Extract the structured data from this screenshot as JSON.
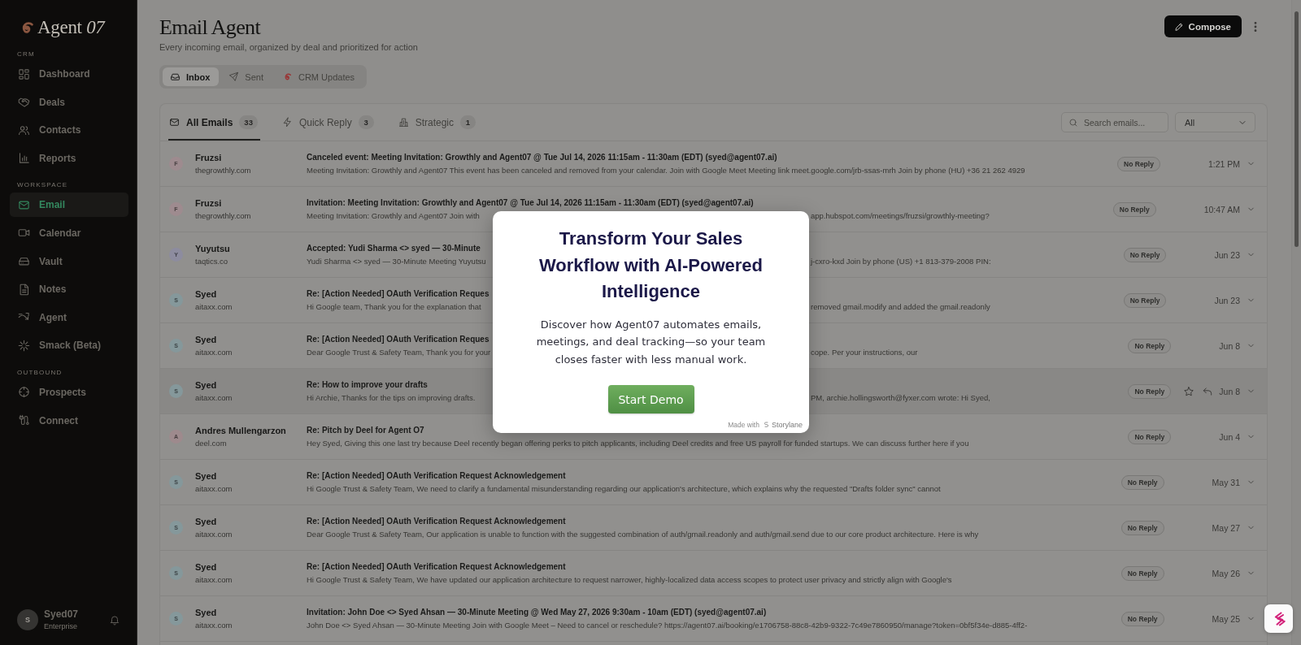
{
  "sidebar": {
    "logo": "Agent *07*",
    "sections": [
      {
        "label": "CRM",
        "items": [
          {
            "label": "Dashboard",
            "selected": false
          },
          {
            "label": "Deals",
            "selected": false
          },
          {
            "label": "Contacts",
            "selected": false
          },
          {
            "label": "Reports",
            "selected": false
          }
        ]
      },
      {
        "label": "WORKSPACE",
        "items": [
          {
            "label": "Email",
            "selected": true
          },
          {
            "label": "Calendar",
            "selected": false
          },
          {
            "label": "Vault",
            "selected": false
          },
          {
            "label": "Notes",
            "selected": false
          },
          {
            "label": "Agent",
            "selected": false
          },
          {
            "label": "Smack (Beta)",
            "selected": false
          }
        ]
      },
      {
        "label": "OUTBOUND",
        "items": [
          {
            "label": "Prospects",
            "selected": false
          },
          {
            "label": "Connect",
            "selected": false
          }
        ]
      }
    ],
    "user": {
      "initial": "S",
      "name": "Syed07",
      "plan": "Enterprise"
    }
  },
  "header": {
    "title": "Email Agent",
    "subtitle": "Every incoming email, organized by deal and prioritized for action",
    "compose_button": "Compose"
  },
  "view_tabs": [
    {
      "label": "Inbox",
      "selected": true
    },
    {
      "label": "Sent",
      "selected": false
    },
    {
      "label": "CRM Updates",
      "selected": false
    }
  ],
  "mail_tabs": [
    {
      "label": "All Emails",
      "count": "33",
      "selected": true
    },
    {
      "label": "Quick Reply",
      "count": "3",
      "selected": false
    },
    {
      "label": "Strategic",
      "count": "1",
      "selected": false
    }
  ],
  "search": {
    "placeholder": "Search emails..."
  },
  "filter": {
    "value": "All"
  },
  "emails": [
    {
      "initial": "F",
      "color": "#9e8b8f",
      "sender": "Fruzsi",
      "domain": "thegrowthly.com",
      "subject": "Canceled event: Meeting Invitation: Growthly and Agent07 @ Tue Jul 14, 2026 11:15am - 11:30am (EDT) (syed@agent07.ai)",
      "preview": "Meeting Invitation: Growthly and Agent07 This event has been canceled and removed from your calendar. Join with Google Meet Meeting link meet.google.com/jrb-ssas-mrh Join by phone (HU) +36 21 262 4929",
      "status": "No Reply",
      "time": "1:21 PM",
      "hovered": false
    },
    {
      "initial": "F",
      "color": "#9e8b8f",
      "sender": "Fruzsi",
      "domain": "thegrowthly.com",
      "subject": "Invitation: Meeting Invitation: Growthly and Agent07 @ Tue Jul 14, 2026 11:15am - 11:30am (EDT) (syed@agent07.ai)",
      "preview": "Meeting Invitation: Growthly and Agent07 Join with",
      "preview_right_part": "app.hubspot.com/meetings/fruzsi/growthly-meeting?",
      "status": "No Reply",
      "time": "10:47 AM",
      "hovered": false
    },
    {
      "initial": "Y",
      "color": "#8d8c9f",
      "sender": "Yuyutsu",
      "domain": "taqtics.co",
      "subject": "Accepted: Yudi Sharma <> syed — 30-Minute",
      "preview": "Yudi Sharma <> syed — 30-Minute Meeting Yuyutsu",
      "preview_right_part": "j-cxro-kxd Join by phone (US) +1 813-379-2008 PIN:",
      "status": "No Reply",
      "time": "Jun 23",
      "hovered": false
    },
    {
      "initial": "S",
      "color": "#85989b",
      "sender": "Syed",
      "domain": "aitaxx.com",
      "subject": "Re: [Action Needed] OAuth Verification Reques",
      "preview": "Hi Google team, Thank you for the explanation that",
      "preview_right_part": "removed gmail.modify and added the gmail.readonly",
      "status": "No Reply",
      "time": "Jun 23",
      "hovered": false
    },
    {
      "initial": "S",
      "color": "#85989b",
      "sender": "Syed",
      "domain": "aitaxx.com",
      "subject": "Re: [Action Needed] OAuth Verification Reques",
      "preview": "Dear Google Trust & Safety Team, Thank you for your",
      "preview_right_part": "cope. Per your instructions, our",
      "status": "No Reply",
      "time": "Jun 8",
      "hovered": false
    },
    {
      "initial": "S",
      "color": "#85989b",
      "sender": "Syed",
      "domain": "aitaxx.com",
      "subject": "Re: How to improve your drafts",
      "preview": "Hi Archie, Thanks for the tips on improving drafts.",
      "preview_right_part": "PM, archie.hollingsworth@fyxer.com wrote: Hi Syed,",
      "status": "No Reply",
      "time": "Jun 8",
      "hovered": true
    },
    {
      "initial": "A",
      "color": "#9e8a8d",
      "sender": "Andres Mullengarzon",
      "domain": "deel.com",
      "subject": "Re: Pitch by Deel for Agent O7",
      "preview": "Hey Syed, Giving this one last try because Deel recently began offering perks to pitch applicants, including Deel credits and free US payroll for funded startups. We can discuss further here if you",
      "status": "No Reply",
      "time": "Jun 4",
      "hovered": false
    },
    {
      "initial": "S",
      "color": "#85989b",
      "sender": "Syed",
      "domain": "aitaxx.com",
      "subject": "Re: [Action Needed] OAuth Verification Request Acknowledgement",
      "preview": "Hi Google Trust & Safety Team, We need to clarify a fundamental misunderstanding regarding our application's architecture, which explains why the requested \"Drafts folder sync\" cannot",
      "status": "No Reply",
      "time": "May 31",
      "hovered": false
    },
    {
      "initial": "S",
      "color": "#85989b",
      "sender": "Syed",
      "domain": "aitaxx.com",
      "subject": "Re: [Action Needed] OAuth Verification Request Acknowledgement",
      "preview": "Dear Google Trust & Safety Team, Our application is unable to function with the suggested combination of auth/gmail.readonly and auth/gmail.send due to our core product architecture. Here is why",
      "status": "No Reply",
      "time": "May 27",
      "hovered": false
    },
    {
      "initial": "S",
      "color": "#85989b",
      "sender": "Syed",
      "domain": "aitaxx.com",
      "subject": "Re: [Action Needed] OAuth Verification Request Acknowledgement",
      "preview": "Hi Google Trust & Safety Team, We have updated our application architecture to request narrower, highly-localized data access scopes to protect user privacy and strictly align with Google's",
      "status": "No Reply",
      "time": "May 26",
      "hovered": false
    },
    {
      "initial": "S",
      "color": "#85989b",
      "sender": "Syed",
      "domain": "aitaxx.com",
      "subject": "Invitation: John Doe <> Syed Ahsan — 30-Minute Meeting @ Wed May 27, 2026 9:30am - 10am (EDT) (syed@agent07.ai)",
      "preview": "John Doe <> Syed Ahsan — 30-Minute Meeting Join with Google Meet – Need to cancel or reschedule? https://agent07.ai/booking/e1706758-88c8-42b9-9322-7c49e7860950/manage?token=0bf5f34e-d885-4ff2-",
      "status": "No Reply",
      "time": "May 25",
      "hovered": false
    }
  ],
  "popup": {
    "title": "Transform Your Sales Workflow with AI-Powered Intelligence",
    "body": "Discover how Agent07 automates emails, meetings, and deal tracking—so your team closes faster with less manual work.",
    "button": "Start Demo",
    "credit": "Made with",
    "brand": "Storylane"
  }
}
